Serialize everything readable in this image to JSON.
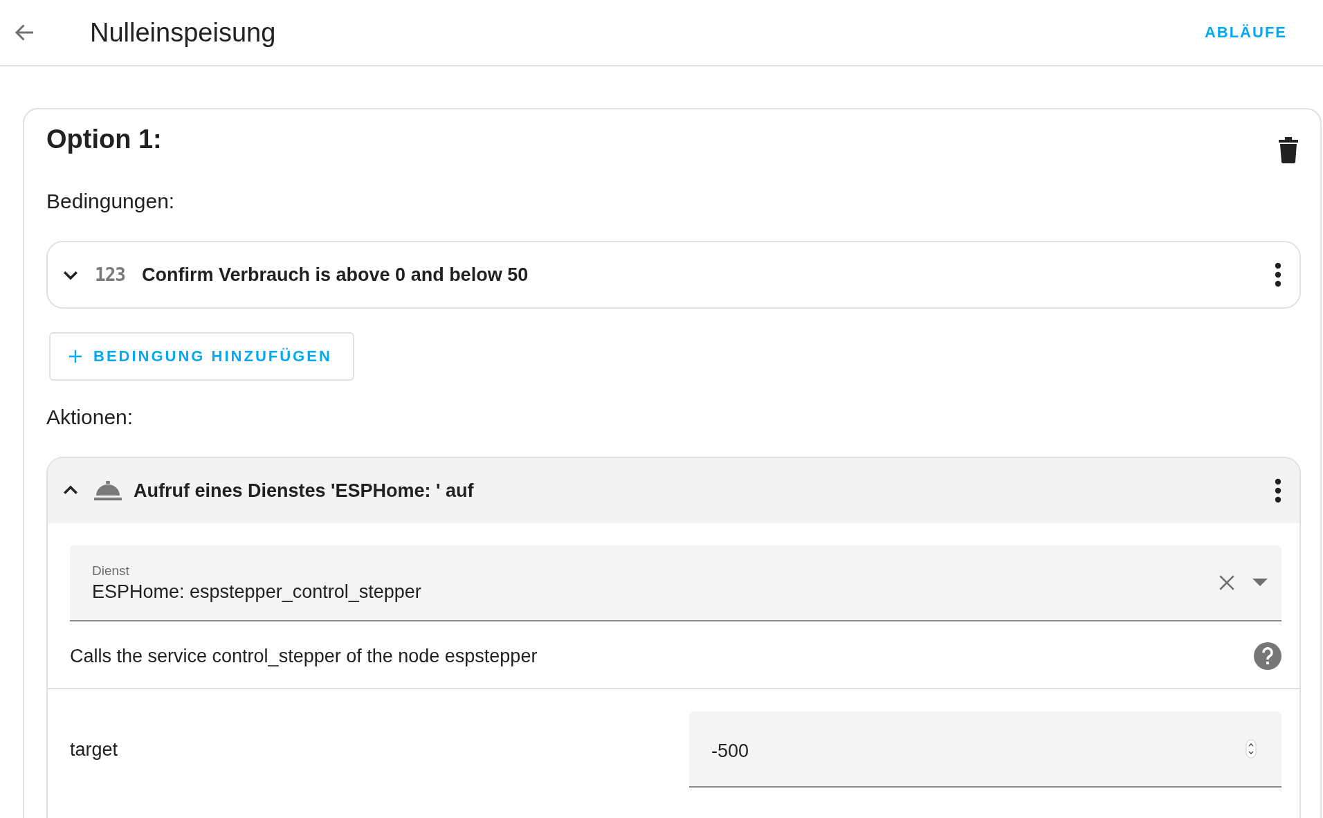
{
  "header": {
    "title": "Nulleinspeisung",
    "action": "ABLÄUFE"
  },
  "option": {
    "title": "Option 1:",
    "conditions_label": "Bedingungen:",
    "conditions": [
      {
        "kind": "numeric",
        "type_label": "123",
        "text": "Confirm Verbrauch is above 0 and below 50",
        "expanded": false
      }
    ],
    "add_condition": "BEDINGUNG HINZUFÜGEN",
    "actions_label": "Aktionen:",
    "actions": [
      {
        "kind": "service",
        "text": "Aufruf eines Dienstes 'ESPHome: ' auf",
        "expanded": true,
        "service_field": {
          "label": "Dienst",
          "value": "ESPHome: espstepper_control_stepper"
        },
        "description": "Calls the service control_stepper of the node espstepper",
        "params": [
          {
            "name": "target",
            "value": "-500"
          }
        ]
      }
    ]
  }
}
